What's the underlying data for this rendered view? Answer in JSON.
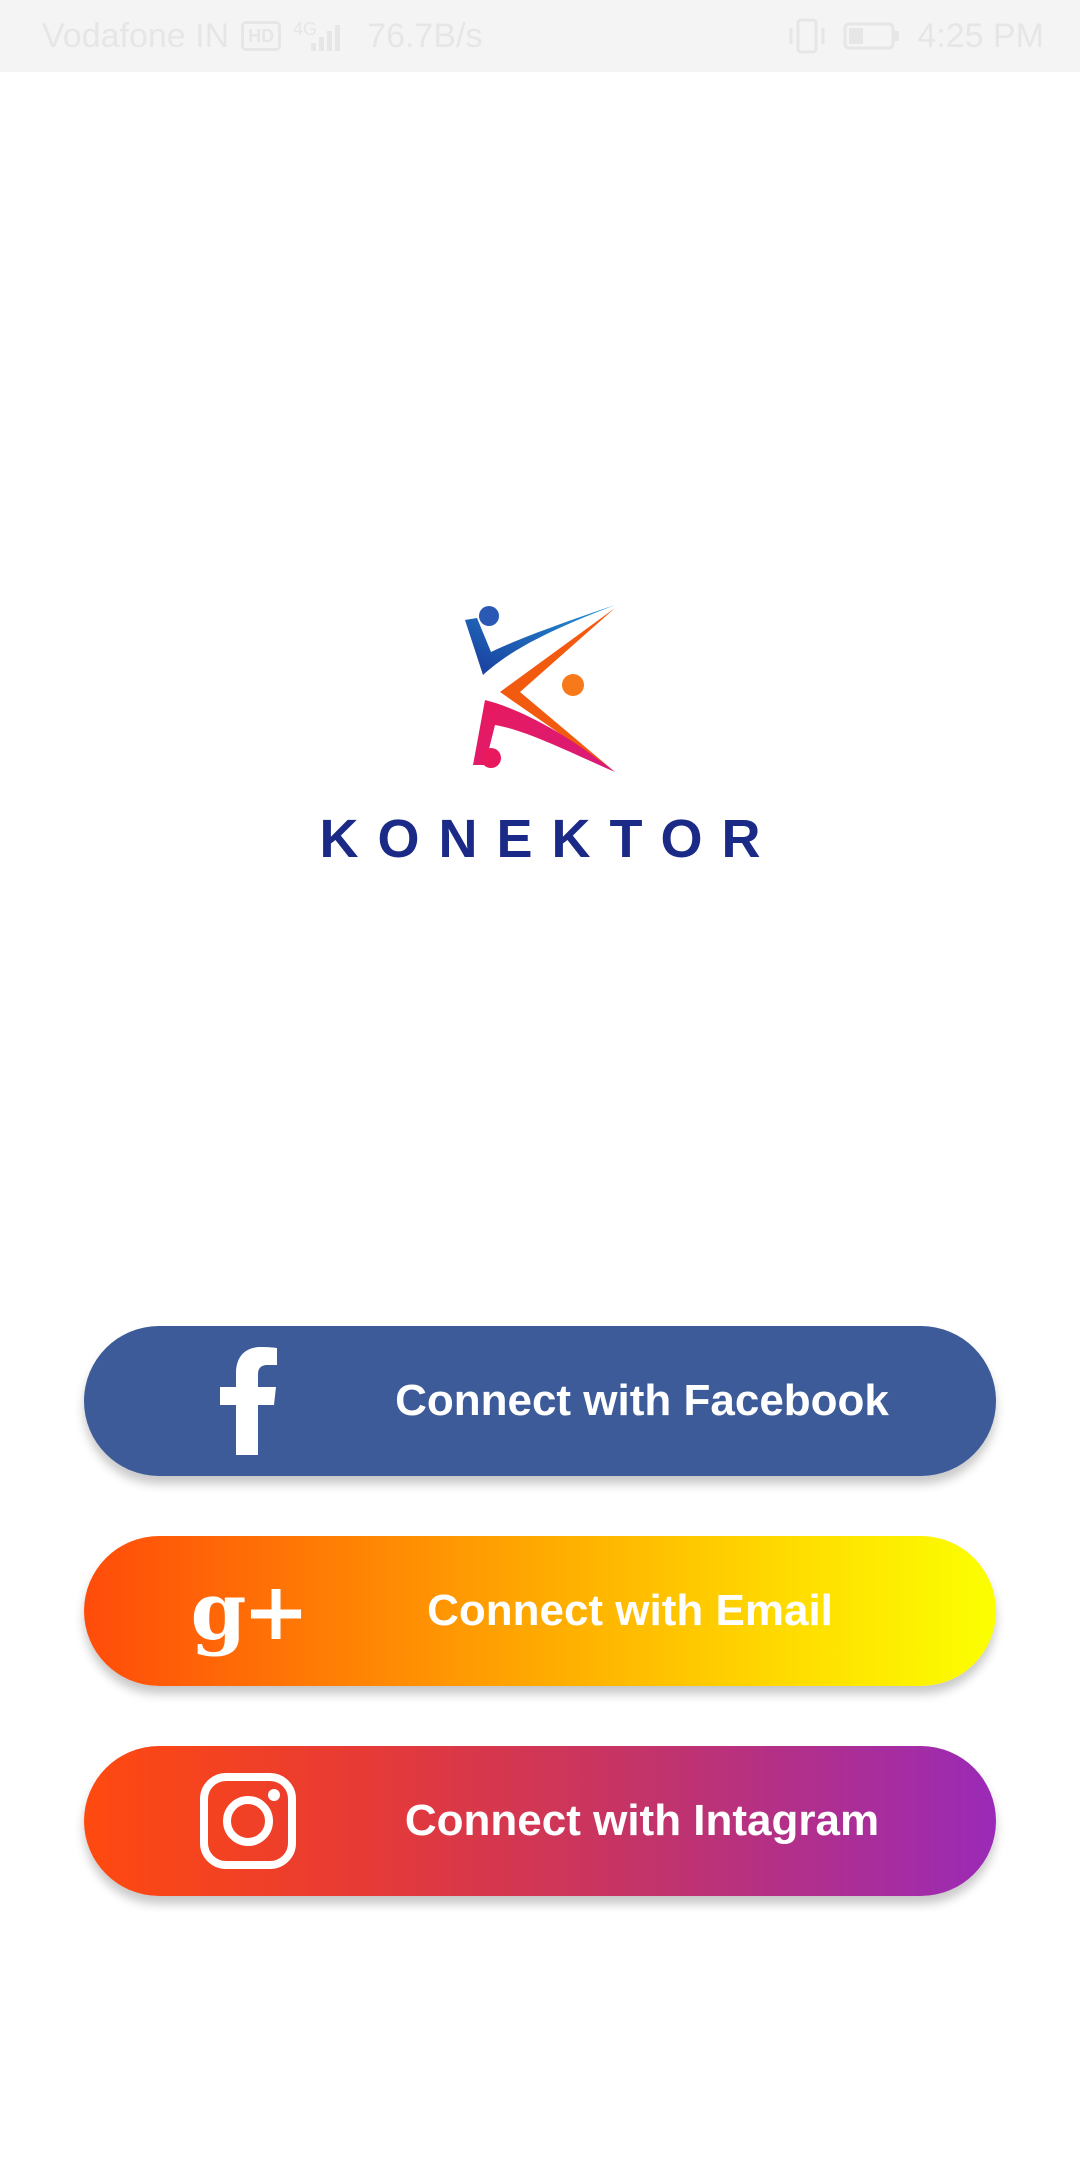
{
  "status_bar": {
    "carrier": "Vodafone IN",
    "network_badge": "HD",
    "data_speed": "76.7B/s",
    "time": "4:25 PM",
    "battery_level": 0.35,
    "icons": [
      "hd-icon",
      "signal-icon",
      "vibrate-icon",
      "battery-icon"
    ]
  },
  "logo": {
    "brand": "KONEKTOR",
    "colors": {
      "blue": "#1b3a9b",
      "cyan": "#2196d8",
      "orange": "#f25a0f",
      "pink": "#e8195c",
      "text": "#1a2a86"
    }
  },
  "buttons": [
    {
      "label": "Connect with Facebook",
      "icon": "facebook-icon",
      "color": "#3d5a99"
    },
    {
      "label": "Connect with Email",
      "icon": "google-plus-icon",
      "gradient": [
        "#ff4b0a",
        "#fbff00"
      ]
    },
    {
      "label": "Connect with Intagram",
      "icon": "instagram-icon",
      "gradient": [
        "#ff4a0f",
        "#9a2ab7"
      ]
    }
  ]
}
